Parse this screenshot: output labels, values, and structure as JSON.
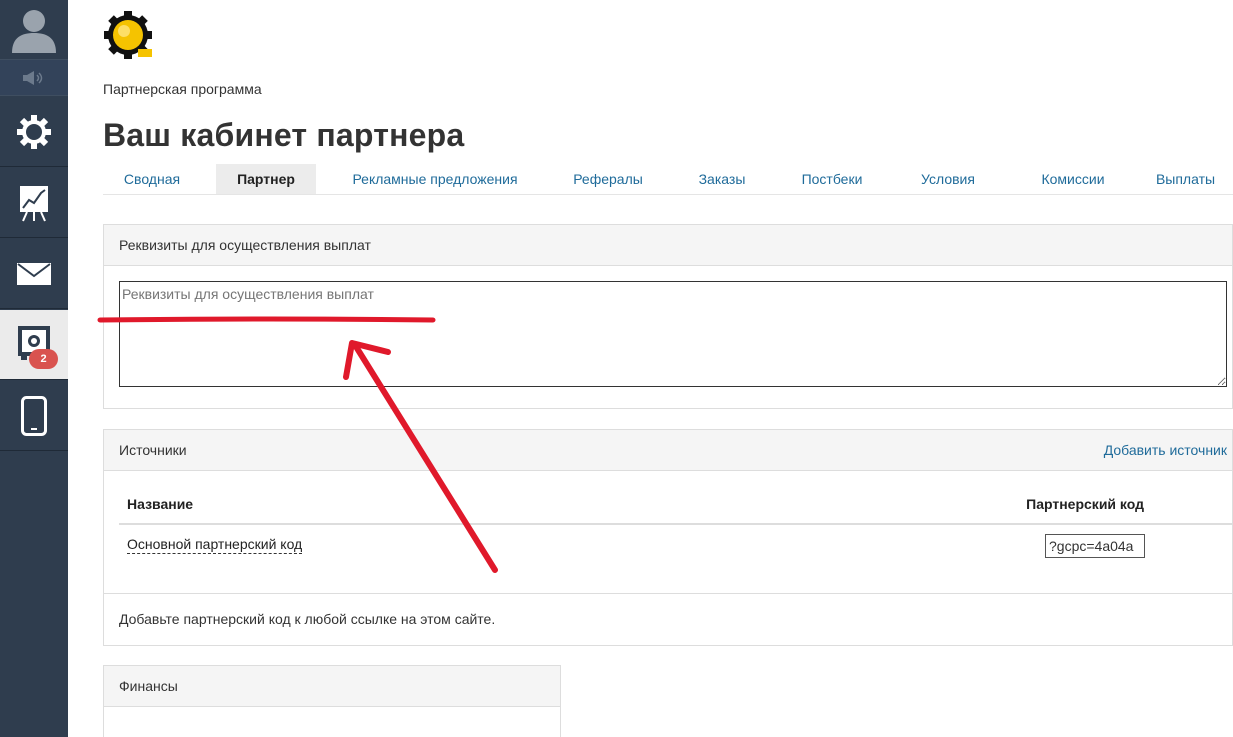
{
  "sidebar": {
    "items": [
      {
        "name": "settings",
        "icon": "gear-icon"
      },
      {
        "name": "stats",
        "icon": "chart-easel-icon"
      },
      {
        "name": "mail",
        "icon": "envelope-icon"
      },
      {
        "name": "partner",
        "icon": "safe-gear-icon",
        "badge": "2",
        "active": true
      },
      {
        "name": "mobile",
        "icon": "phone-icon"
      }
    ]
  },
  "header": {
    "subtitle": "Партнерская программа",
    "title": "Ваш кабинет партнера"
  },
  "tabs": [
    {
      "label": "Сводная"
    },
    {
      "label": "Партнер",
      "active": true
    },
    {
      "label": "Рекламные предложения"
    },
    {
      "label": "Рефералы"
    },
    {
      "label": "Заказы"
    },
    {
      "label": "Постбеки"
    },
    {
      "label": "Условия"
    },
    {
      "label": "Комиссии"
    },
    {
      "label": "Выплаты"
    }
  ],
  "payout": {
    "heading": "Реквизиты для осуществления выплат",
    "placeholder": "Реквизиты для осуществления выплат"
  },
  "sources": {
    "heading": "Источники",
    "add_link": "Добавить источник",
    "col_name": "Название",
    "col_code": "Партнерский код",
    "rows": [
      {
        "name": "Основной партнерский код",
        "code": "?gcpc=4a04a"
      }
    ],
    "footer": "Добавьте партнерский код к любой ссылке на этом сайте."
  },
  "finance": {
    "heading": "Финансы"
  },
  "colors": {
    "sidebar_bg": "#2f3d4e",
    "link": "#1f6b9a",
    "annotation": "#e0192b",
    "badge": "#d9534f"
  }
}
